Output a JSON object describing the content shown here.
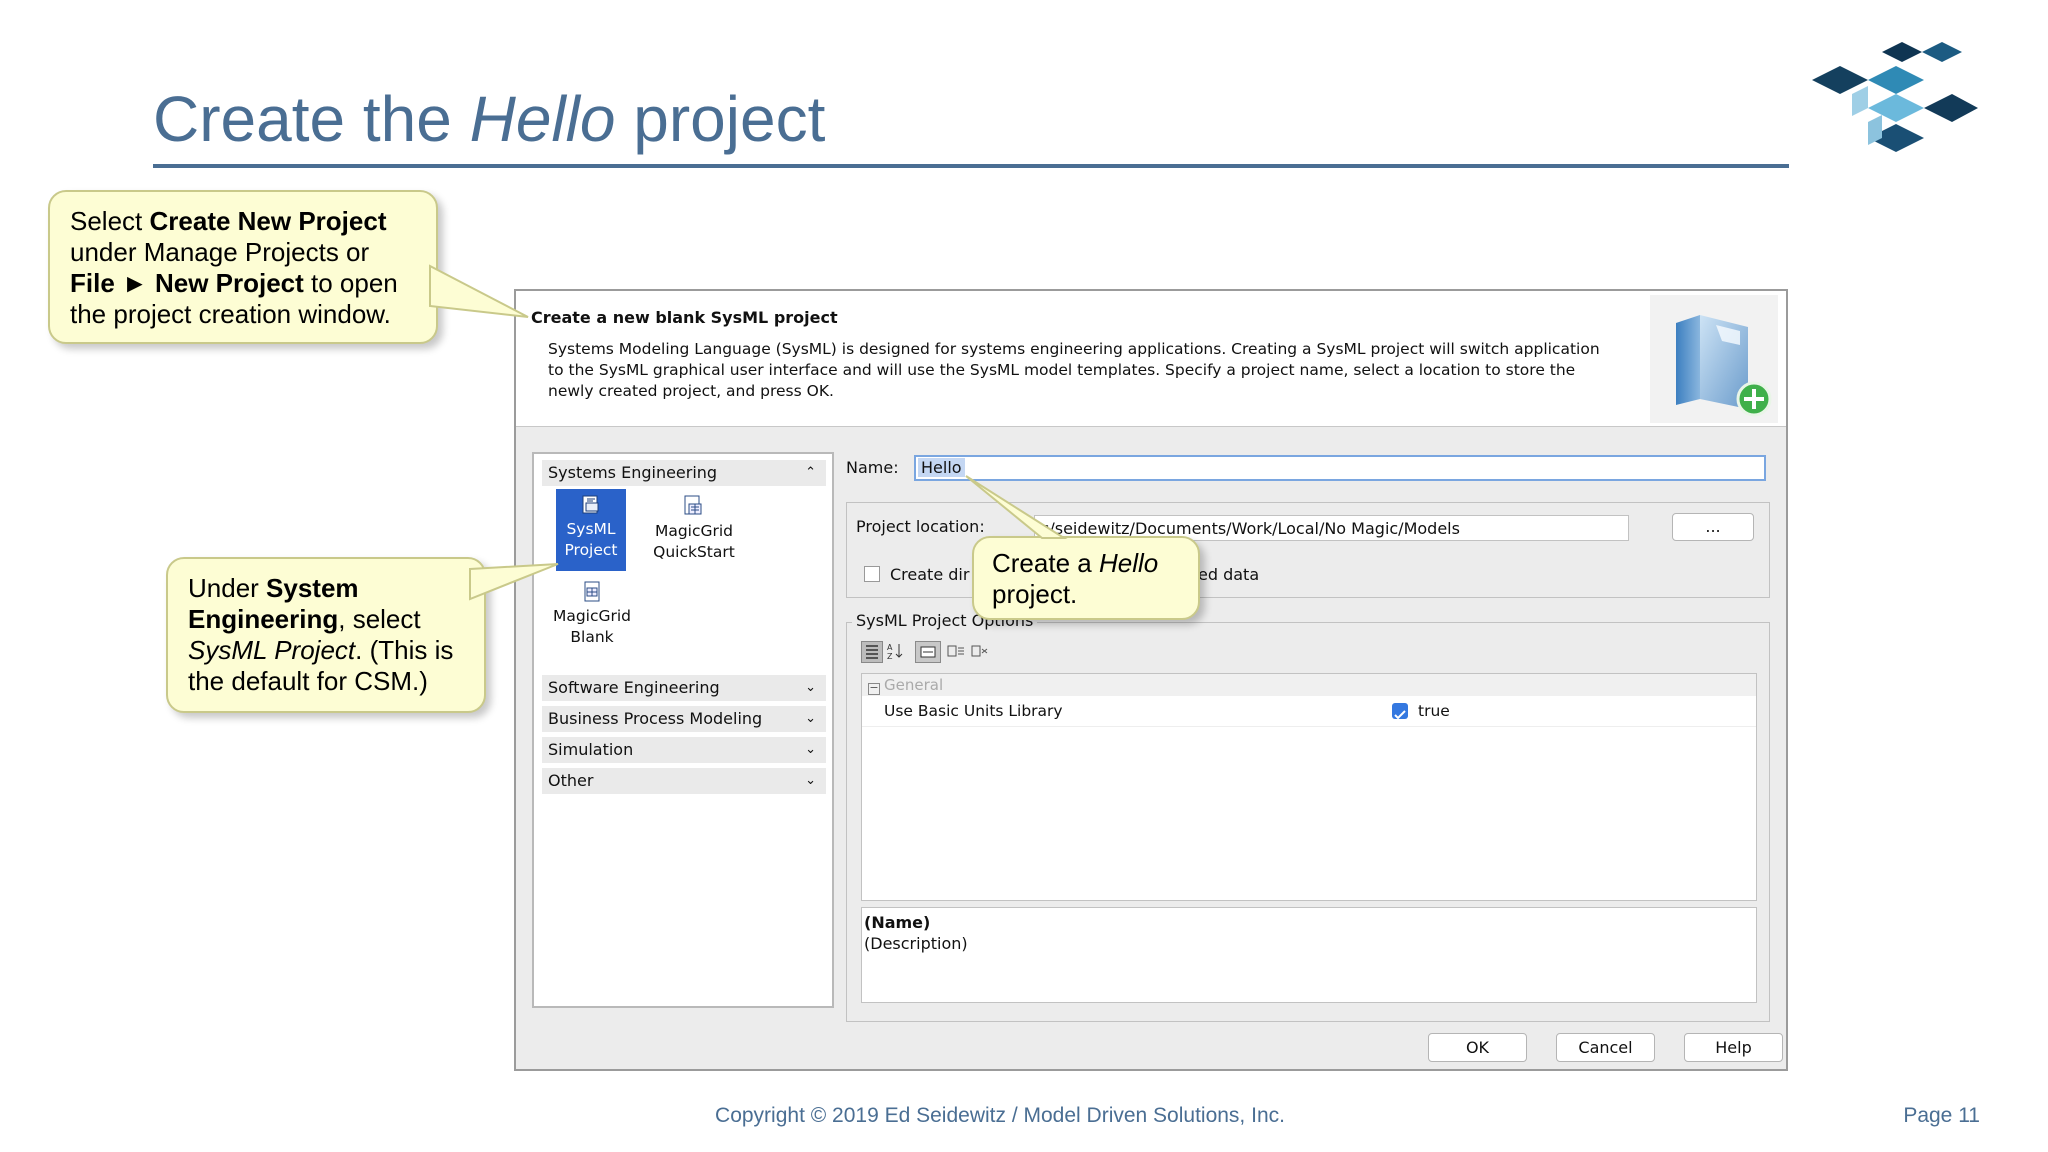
{
  "slide": {
    "title_pre": "Create the ",
    "title_em": "Hello",
    "title_post": " project",
    "copyright": "Copyright © 2019 Ed Seidewitz / Model Driven Solutions, Inc.",
    "page": "Page 11",
    "accent_color": "#4a6e93"
  },
  "callouts": {
    "first": {
      "t1": "Select ",
      "b1": "Create New Project",
      "t2": " under Manage Projects or ",
      "b2": "File ► New Project",
      "t3": " to open the project creation window."
    },
    "second": {
      "t1": "Under ",
      "b1": "System Engineering",
      "t2": ", select ",
      "i1": "SysML Project",
      "t3": ". (This is the default for CSM.)"
    },
    "third": {
      "t1": "Create a ",
      "i1": "Hello",
      "t2": " project."
    }
  },
  "dialog": {
    "header_title": "Create a new blank SysML project",
    "header_desc": "Systems Modeling Language (SysML) is designed for systems engineering applications. Creating a SysML project will switch application to the SysML graphical user interface and will use the SysML model templates. Specify a project name, select a location to store the newly created project, and press OK.",
    "categories": {
      "systems": "Systems Engineering",
      "software": "Software Engineering",
      "business": "Business Process Modeling",
      "simulation": "Simulation",
      "other": "Other"
    },
    "templates": {
      "sysml_1": "SysML",
      "sysml_2": "Project",
      "quickstart_1": "MagicGrid",
      "quickstart_2": "QuickStart",
      "blank_1": "MagicGrid",
      "blank_2": "Blank"
    },
    "name_label": "Name:",
    "name_value": "Hello",
    "location_label": "Project location:",
    "location_value": "s/seidewitz/Documents/Work/Local/No Magic/Models",
    "browse_label": "...",
    "create_dir_label": "Create dir",
    "create_dir_tail": "ed data",
    "options_legend": "SysML Project Options",
    "general_label": "General",
    "prop_name": "Use Basic Units Library",
    "prop_value": "true",
    "desc_name": "(Name)",
    "desc_text": "(Description)",
    "ok": "OK",
    "cancel": "Cancel",
    "help": "Help"
  }
}
